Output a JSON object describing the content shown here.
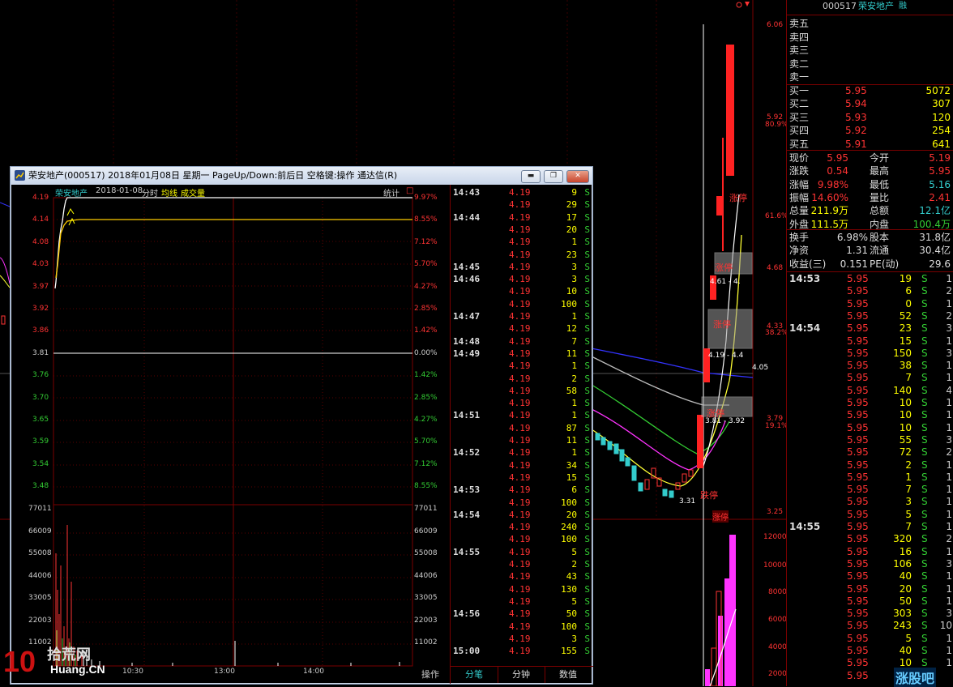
{
  "background_chart": {
    "price_labels": [
      "6.06",
      "5.92",
      "4.68",
      "4.33",
      "3.79",
      "3.25"
    ],
    "pct_labels": [
      "80.9%",
      "61.6%",
      "38.2%",
      "19.1%"
    ],
    "volume_labels": [
      "12000",
      "10000",
      "8000",
      "6000",
      "4000",
      "2000"
    ],
    "annotations": {
      "zhangting_top": "涨停",
      "zhangting_mid": "涨停",
      "zhangting_mid2": "涨停",
      "zhangting_low": "涨停",
      "dieting": "跌停",
      "zt_low_bottom": "涨停",
      "price_marker_1": "4.61 - 4.",
      "price_marker_2": "4.19 - 4.4",
      "price_marker_3": "3.81 - 3.92",
      "low_marker": "3.31",
      "last_price_marker": "4.05",
      "bottom_tag": "涨停"
    }
  },
  "right_panel": {
    "code": "000517",
    "name": "荣安地产",
    "tag": "融",
    "order_book": [
      {
        "label": "卖五",
        "price": "",
        "vol": ""
      },
      {
        "label": "卖四",
        "price": "",
        "vol": ""
      },
      {
        "label": "卖三",
        "price": "",
        "vol": ""
      },
      {
        "label": "卖二",
        "price": "",
        "vol": ""
      },
      {
        "label": "卖一",
        "price": "",
        "vol": ""
      },
      {
        "label": "买一",
        "price": "5.95",
        "vol": "5072"
      },
      {
        "label": "买二",
        "price": "5.94",
        "vol": "307"
      },
      {
        "label": "买三",
        "price": "5.93",
        "vol": "120"
      },
      {
        "label": "买四",
        "price": "5.92",
        "vol": "254"
      },
      {
        "label": "买五",
        "price": "5.91",
        "vol": "641"
      }
    ],
    "stats": [
      {
        "l1": "现价",
        "v1": "5.95",
        "l2": "今开",
        "v2": "5.19"
      },
      {
        "l1": "涨跌",
        "v1": "0.54",
        "l2": "最高",
        "v2": "5.95"
      },
      {
        "l1": "涨幅",
        "v1": "9.98%",
        "l2": "最低",
        "v2": "5.16"
      },
      {
        "l1": "振幅",
        "v1": "14.60%",
        "l2": "量比",
        "v2": "2.41"
      },
      {
        "l1": "总量",
        "v1": "211.9万",
        "l2": "总额",
        "v2": "12.1亿"
      },
      {
        "l1": "外盘",
        "v1": "111.5万",
        "l2": "内盘",
        "v2": "100.4万"
      }
    ],
    "stats2": [
      {
        "l1": "换手",
        "v1": "6.98%",
        "l2": "股本",
        "v2": "31.8亿"
      },
      {
        "l1": "净资",
        "v1": "1.31",
        "l2": "流通",
        "v2": "30.4亿"
      },
      {
        "l1": "收益(三)",
        "v1": "0.151",
        "l2": "PE(动)",
        "v2": "29.6"
      }
    ],
    "trades": [
      {
        "t": "14:53",
        "p": "5.95",
        "v": "19",
        "s": "S",
        "n": "1"
      },
      {
        "t": "",
        "p": "5.95",
        "v": "6",
        "s": "S",
        "n": "2"
      },
      {
        "t": "",
        "p": "5.95",
        "v": "0",
        "s": "S",
        "n": "1"
      },
      {
        "t": "",
        "p": "5.95",
        "v": "52",
        "s": "S",
        "n": "2"
      },
      {
        "t": "14:54",
        "p": "5.95",
        "v": "23",
        "s": "S",
        "n": "3"
      },
      {
        "t": "",
        "p": "5.95",
        "v": "15",
        "s": "S",
        "n": "1"
      },
      {
        "t": "",
        "p": "5.95",
        "v": "150",
        "s": "S",
        "n": "3"
      },
      {
        "t": "",
        "p": "5.95",
        "v": "38",
        "s": "S",
        "n": "1"
      },
      {
        "t": "",
        "p": "5.95",
        "v": "7",
        "s": "S",
        "n": "1"
      },
      {
        "t": "",
        "p": "5.95",
        "v": "140",
        "s": "S",
        "n": "4"
      },
      {
        "t": "",
        "p": "5.95",
        "v": "10",
        "s": "S",
        "n": "1"
      },
      {
        "t": "",
        "p": "5.95",
        "v": "10",
        "s": "S",
        "n": "1"
      },
      {
        "t": "",
        "p": "5.95",
        "v": "10",
        "s": "S",
        "n": "1"
      },
      {
        "t": "",
        "p": "5.95",
        "v": "55",
        "s": "S",
        "n": "3"
      },
      {
        "t": "",
        "p": "5.95",
        "v": "72",
        "s": "S",
        "n": "2"
      },
      {
        "t": "",
        "p": "5.95",
        "v": "2",
        "s": "S",
        "n": "1"
      },
      {
        "t": "",
        "p": "5.95",
        "v": "1",
        "s": "S",
        "n": "1"
      },
      {
        "t": "",
        "p": "5.95",
        "v": "7",
        "s": "S",
        "n": "1"
      },
      {
        "t": "",
        "p": "5.95",
        "v": "3",
        "s": "S",
        "n": "1"
      },
      {
        "t": "",
        "p": "5.95",
        "v": "5",
        "s": "S",
        "n": "1"
      },
      {
        "t": "14:55",
        "p": "5.95",
        "v": "7",
        "s": "S",
        "n": "1"
      },
      {
        "t": "",
        "p": "5.95",
        "v": "320",
        "s": "S",
        "n": "2"
      },
      {
        "t": "",
        "p": "5.95",
        "v": "16",
        "s": "S",
        "n": "1"
      },
      {
        "t": "",
        "p": "5.95",
        "v": "106",
        "s": "S",
        "n": "3"
      },
      {
        "t": "",
        "p": "5.95",
        "v": "40",
        "s": "S",
        "n": "1"
      },
      {
        "t": "",
        "p": "5.95",
        "v": "20",
        "s": "S",
        "n": "1"
      },
      {
        "t": "",
        "p": "5.95",
        "v": "50",
        "s": "S",
        "n": "1"
      },
      {
        "t": "",
        "p": "5.95",
        "v": "303",
        "s": "S",
        "n": "3"
      },
      {
        "t": "",
        "p": "5.95",
        "v": "243",
        "s": "S",
        "n": "10"
      },
      {
        "t": "",
        "p": "5.95",
        "v": "5",
        "s": "S",
        "n": "1"
      },
      {
        "t": "",
        "p": "5.95",
        "v": "40",
        "s": "S",
        "n": "1"
      },
      {
        "t": "",
        "p": "5.95",
        "v": "10",
        "s": "S",
        "n": "1"
      },
      {
        "t": "",
        "p": "5.95",
        "v": "",
        "s": "S",
        "n": ""
      }
    ]
  },
  "window": {
    "title": "荣安地产(000517) 2018年01月08日 星期一 PageUp/Down:前后日 空格键:操作 通达信(R)",
    "header_name": "荣安地产",
    "header_date": "2018-01-08",
    "header_fenshi": "分时",
    "header_junxian": "均线",
    "header_volume": "成交量",
    "stats_button": "统计",
    "price_axis": [
      "4.19",
      "4.14",
      "4.08",
      "4.03",
      "3.97",
      "3.92",
      "3.86",
      "3.81",
      "3.76",
      "3.70",
      "3.65",
      "3.59",
      "3.54",
      "3.48"
    ],
    "pct_axis": [
      "9.97%",
      "8.55%",
      "7.12%",
      "5.70%",
      "4.27%",
      "2.85%",
      "1.42%",
      "0.00%",
      "1.42%",
      "2.85%",
      "4.27%",
      "5.70%",
      "7.12%",
      "8.55%"
    ],
    "vol_axis": [
      "77011",
      "66009",
      "55008",
      "44006",
      "33005",
      "22003",
      "11002"
    ],
    "time_axis": [
      "10:30",
      "13:00",
      "14:00"
    ],
    "op_label": "操作",
    "ticks": [
      {
        "t": "14:43",
        "p": "4.19",
        "v": "9",
        "s": "S"
      },
      {
        "t": "",
        "p": "4.19",
        "v": "29",
        "s": "S"
      },
      {
        "t": "14:44",
        "p": "4.19",
        "v": "17",
        "s": "S"
      },
      {
        "t": "",
        "p": "4.19",
        "v": "20",
        "s": "S"
      },
      {
        "t": "",
        "p": "4.19",
        "v": "1",
        "s": "S"
      },
      {
        "t": "",
        "p": "4.19",
        "v": "23",
        "s": "S"
      },
      {
        "t": "14:45",
        "p": "4.19",
        "v": "3",
        "s": "S"
      },
      {
        "t": "14:46",
        "p": "4.19",
        "v": "3",
        "s": "S"
      },
      {
        "t": "",
        "p": "4.19",
        "v": "10",
        "s": "S"
      },
      {
        "t": "",
        "p": "4.19",
        "v": "100",
        "s": "S"
      },
      {
        "t": "14:47",
        "p": "4.19",
        "v": "1",
        "s": "S"
      },
      {
        "t": "",
        "p": "4.19",
        "v": "12",
        "s": "S"
      },
      {
        "t": "14:48",
        "p": "4.19",
        "v": "7",
        "s": "S"
      },
      {
        "t": "14:49",
        "p": "4.19",
        "v": "11",
        "s": "S"
      },
      {
        "t": "",
        "p": "4.19",
        "v": "1",
        "s": "S"
      },
      {
        "t": "",
        "p": "4.19",
        "v": "2",
        "s": "S"
      },
      {
        "t": "",
        "p": "4.19",
        "v": "58",
        "s": "S"
      },
      {
        "t": "",
        "p": "4.19",
        "v": "1",
        "s": "S"
      },
      {
        "t": "14:51",
        "p": "4.19",
        "v": "1",
        "s": "S"
      },
      {
        "t": "",
        "p": "4.19",
        "v": "87",
        "s": "S"
      },
      {
        "t": "",
        "p": "4.19",
        "v": "11",
        "s": "S"
      },
      {
        "t": "14:52",
        "p": "4.19",
        "v": "1",
        "s": "S"
      },
      {
        "t": "",
        "p": "4.19",
        "v": "34",
        "s": "S"
      },
      {
        "t": "",
        "p": "4.19",
        "v": "15",
        "s": "S"
      },
      {
        "t": "14:53",
        "p": "4.19",
        "v": "6",
        "s": "S"
      },
      {
        "t": "",
        "p": "4.19",
        "v": "100",
        "s": "S"
      },
      {
        "t": "14:54",
        "p": "4.19",
        "v": "20",
        "s": "S"
      },
      {
        "t": "",
        "p": "4.19",
        "v": "240",
        "s": "S"
      },
      {
        "t": "",
        "p": "4.19",
        "v": "100",
        "s": "S"
      },
      {
        "t": "14:55",
        "p": "4.19",
        "v": "5",
        "s": "S"
      },
      {
        "t": "",
        "p": "4.19",
        "v": "2",
        "s": "S"
      },
      {
        "t": "",
        "p": "4.19",
        "v": "43",
        "s": "S"
      },
      {
        "t": "",
        "p": "4.19",
        "v": "130",
        "s": "S"
      },
      {
        "t": "",
        "p": "4.19",
        "v": "5",
        "s": "S"
      },
      {
        "t": "14:56",
        "p": "4.19",
        "v": "50",
        "s": "S"
      },
      {
        "t": "",
        "p": "4.19",
        "v": "100",
        "s": "S"
      },
      {
        "t": "",
        "p": "4.19",
        "v": "3",
        "s": "S"
      },
      {
        "t": "15:00",
        "p": "4.19",
        "v": "155",
        "s": "S"
      }
    ],
    "tabs": [
      "分笔",
      "分钟",
      "数值"
    ]
  },
  "watermarks": {
    "left_brand": "拾荒网",
    "left_domain": "Huang.CN",
    "left_digits": "10",
    "right_brand": "涨股吧"
  },
  "colors": {
    "up": "#ff3333",
    "down": "#33cccc",
    "flat": "#ffffff",
    "yellow": "#ffff00",
    "magenta": "#ff33ff",
    "grid": "#7a0000"
  }
}
